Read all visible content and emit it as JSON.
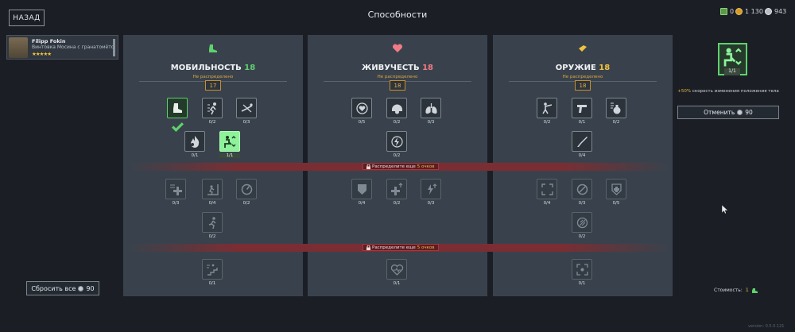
{
  "header": {
    "back_label": "НАЗАД",
    "title": "Способности"
  },
  "currency": [
    {
      "icon": "green-ticket-icon",
      "value": "0"
    },
    {
      "icon": "gold-coin-icon",
      "value": "1 130"
    },
    {
      "icon": "silver-coin-icon",
      "value": "943"
    }
  ],
  "soldier": {
    "name": "Filipp Fokin",
    "weapon": "Винтовка Мосина с гранатомётом Д",
    "stars": "★★★★★"
  },
  "panels": [
    {
      "title": "МОБИЛЬНОСТЬ",
      "points": "18",
      "sub": "Не распределено",
      "value": "17",
      "num_color": "#5fd16d",
      "skills": [
        "0/1",
        "0/2",
        "0/3",
        "0/1",
        "1/1",
        "0/3",
        "0/4",
        "0/2",
        "0/2",
        "0/1"
      ]
    },
    {
      "title": "ЖИВУЧЕСТЬ",
      "points": "18",
      "sub": "Не распределено",
      "value": "18",
      "num_color": "#f07a86",
      "skills": [
        "0/5",
        "0/2",
        "0/3",
        "0/2",
        "0/4",
        "0/2",
        "0/3",
        "0/1"
      ]
    },
    {
      "title": "ОРУЖИЕ",
      "points": "18",
      "sub": "Не распределено",
      "value": "18",
      "num_color": "#f0c33c",
      "skills": [
        "0/2",
        "0/1",
        "0/2",
        "0/4",
        "0/4",
        "0/3",
        "0/5",
        "0/2",
        "0/1"
      ]
    }
  ],
  "locks": [
    {
      "text": "Распределите еще",
      "amount": "5 очков"
    },
    {
      "text": "Распределите еще",
      "amount": "5 очков"
    }
  ],
  "right": {
    "level": "1/1",
    "desc_hl": "+50%",
    "desc": "скорость изменения положения тела",
    "cancel_label": "Отменить",
    "cancel_cost": "90"
  },
  "reset": {
    "label": "Сбросить все",
    "cost": "90"
  },
  "cost": {
    "label": "Стоимость:",
    "value": "1"
  },
  "version": "version: 0.5.0.121"
}
